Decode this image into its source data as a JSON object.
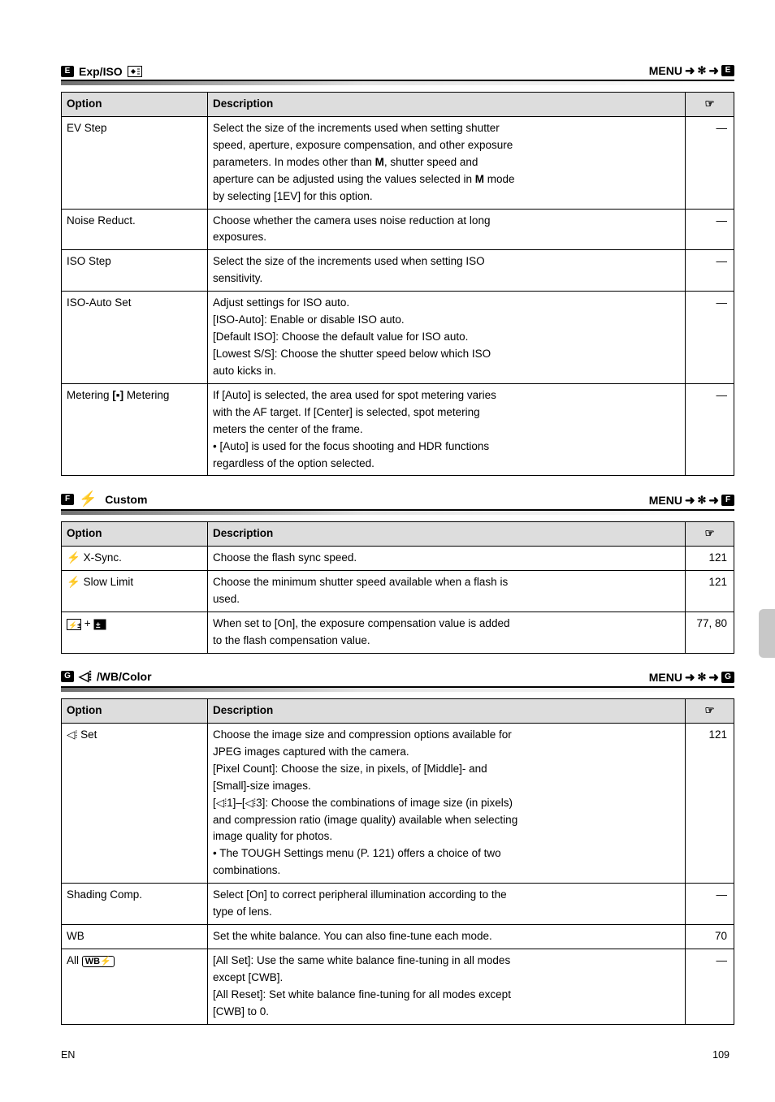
{
  "nav": {
    "menu_label": "MENU",
    "arrow": "➜",
    "gear_glyph": "✻"
  },
  "sectionE": {
    "tab_glyph": "E",
    "title": "Exp/ISO",
    "th_option": "Option",
    "th_desc": "Description",
    "th_page_icon": "☞",
    "rows": [
      {
        "option": "EV Step",
        "desc_line1": "Select the size of the increments used when setting shutter",
        "desc_line2": "speed, aperture, exposure compensation, and other exposure",
        "desc_line3a": "parameters. In modes other than ",
        "desc_line3b": ", shutter speed and",
        "desc_line4a": "aperture can be adjusted using the values selected in ",
        "desc_line4b": " mode",
        "desc_line5": "by selecting [1EV] for this option.",
        "page": "—"
      },
      {
        "option": "Noise Reduct.",
        "desc_line1": "Choose whether the camera uses noise reduction at long",
        "desc_line2": "exposures.",
        "page": "—"
      },
      {
        "option": "ISO Step",
        "desc_line1": "Select the size of the increments used when setting ISO",
        "desc_line2": "sensitivity.",
        "page": "—"
      },
      {
        "option": "ISO-Auto Set",
        "desc_line1": "Adjust settings for ISO auto.",
        "desc_line2": "[ISO-Auto]: Enable or disable ISO auto.",
        "desc_line3": "[Default ISO]: Choose the default value for ISO auto.",
        "desc_line4": "[Lowest S/S]: Choose the shutter speed below which ISO",
        "desc_line5": "auto kicks in.",
        "page": "—"
      },
      {
        "option_part1": "Metering ",
        "option_part2": " Metering",
        "spot_glyph": "[▪]",
        "desc_line1": "If [Auto] is selected, the area used for spot metering varies",
        "desc_line2": "with the AF target. If [Center] is selected, spot metering",
        "desc_line3": "meters the center of the frame.",
        "desc_line4": "• [Auto] is used for the focus shooting and HDR functions",
        "desc_line5": "regardless of the option selected.",
        "page": "—"
      }
    ]
  },
  "sectionF": {
    "tab_glyph": "F",
    "title": " Custom",
    "flash_glyph": "⚡",
    "th_option": "Option",
    "th_desc": "Description",
    "th_page_icon": "☞",
    "rows": [
      {
        "icon_glyph": "⚡",
        "option": "X-Sync.",
        "desc": "Choose the flash sync speed.",
        "page": "121"
      },
      {
        "icon_glyph": "⚡",
        "option": "Slow Limit",
        "desc_line1": "Choose the minimum shutter speed available when a flash is",
        "desc_line2": "used.",
        "page": "121"
      },
      {
        "option_pre": "",
        "option_icons": true,
        "option": "+",
        "desc_line1": "When set to [On], the exposure compensation value is added",
        "desc_line2": "to the flash compensation value.",
        "page": "77, 80"
      }
    ]
  },
  "sectionG": {
    "tab_glyph": "G",
    "title": "/WB/Color",
    "qual_glyph": "◁⦙",
    "th_option": "Option",
    "th_desc": "Description",
    "th_page_icon": "☞",
    "rows": [
      {
        "option_icon": "◁⦙",
        "option": "Set",
        "desc": [
          "Choose the image size and compression options available for",
          "JPEG images captured with the camera.",
          "[Pixel Count]: Choose the size, in pixels, of [Middle]- and",
          "[Small]-size images.",
          "[◁⦙1]–[◁⦙3]: Choose the combinations of image size (in pixels)",
          "and compression ratio (image quality) available when selecting",
          "image quality for photos.",
          "• The TOUGH Settings menu (P. 121) offers a choice of two",
          "combinations."
        ],
        "page": "121"
      },
      {
        "option": "Shading Comp.",
        "desc": [
          "Select [On] to correct peripheral illumination according to the",
          "type of lens."
        ],
        "page": "—"
      },
      {
        "option": "WB",
        "desc": [
          "Set the white balance. You can also fine-tune each mode."
        ],
        "page": "70"
      },
      {
        "option_pre": "All ",
        "option_icon_box": "WB⚡",
        "desc": [
          "[All Set]: Use the same white balance fine-tuning in all modes",
          "except [CWB].",
          "[All Reset]: Set white balance fine-tuning for all modes except",
          "[CWB] to 0."
        ],
        "page": "—"
      }
    ]
  },
  "footer": {
    "left": "EN",
    "right": "109"
  }
}
